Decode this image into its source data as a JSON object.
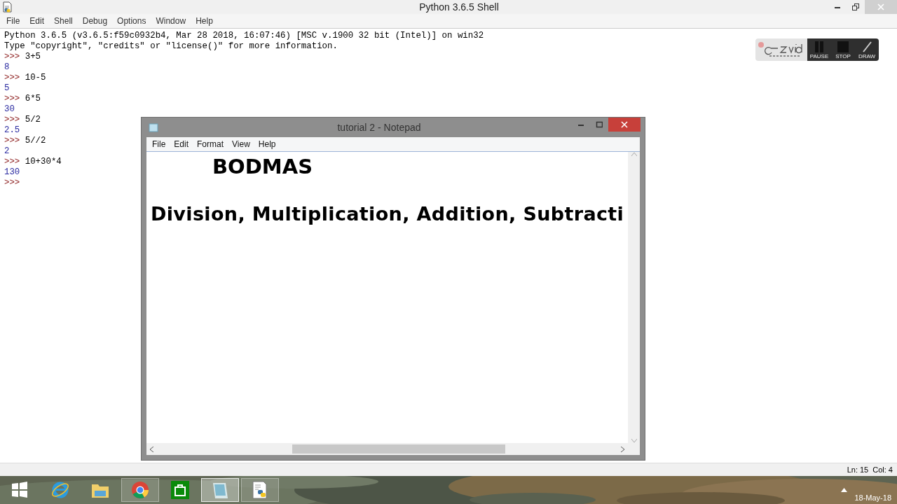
{
  "shell": {
    "title": "Python 3.6.5 Shell",
    "menu": [
      {
        "label": "File"
      },
      {
        "label": "Edit"
      },
      {
        "label": "Shell"
      },
      {
        "label": "Debug"
      },
      {
        "label": "Options"
      },
      {
        "label": "Window"
      },
      {
        "label": "Help"
      }
    ],
    "banner": [
      "Python 3.6.5 (v3.6.5:f59c0932b4, Mar 28 2018, 16:07:46) [MSC v.1900 32 bit (Intel)] on win32",
      "Type \"copyright\", \"credits\" or \"license()\" for more information."
    ],
    "entries": [
      {
        "prompt": ">>>",
        "input": "3+5",
        "output": "8"
      },
      {
        "prompt": ">>>",
        "input": "10-5",
        "output": "5"
      },
      {
        "prompt": ">>>",
        "input": "6*5",
        "output": "30"
      },
      {
        "prompt": ">>>",
        "input": "5/2",
        "output": "2.5"
      },
      {
        "prompt": ">>>",
        "input": "5//2",
        "output": "2"
      },
      {
        "prompt": ">>>",
        "input": "10+30*4",
        "output": "130"
      },
      {
        "prompt": ">>>"
      }
    ],
    "status": {
      "line": "Ln: 15",
      "col": "Col: 4"
    }
  },
  "notepad": {
    "title": "tutorial 2 - Notepad",
    "menu": [
      {
        "label": "File"
      },
      {
        "label": "Edit"
      },
      {
        "label": "Format"
      },
      {
        "label": "View"
      },
      {
        "label": "Help"
      }
    ],
    "heading": "BODMAS",
    "line": "Division, Multiplication, Addition, Subtracti"
  },
  "recorder": {
    "buttons": [
      {
        "kind": "pause",
        "label": "PAUSE"
      },
      {
        "kind": "stop",
        "label": "STOP"
      },
      {
        "kind": "draw",
        "label": "DRAW"
      }
    ]
  },
  "taskbar": {
    "items": [
      {
        "kind": "start",
        "running": false,
        "active": false
      },
      {
        "kind": "ie",
        "running": false,
        "active": false
      },
      {
        "kind": "folder",
        "running": false,
        "active": false
      },
      {
        "kind": "chrome",
        "running": true,
        "active": false
      },
      {
        "kind": "store",
        "running": false,
        "active": false
      },
      {
        "kind": "notepad",
        "running": true,
        "active": true
      },
      {
        "kind": "python",
        "running": true,
        "active": false
      }
    ],
    "date": "18-May-18"
  }
}
